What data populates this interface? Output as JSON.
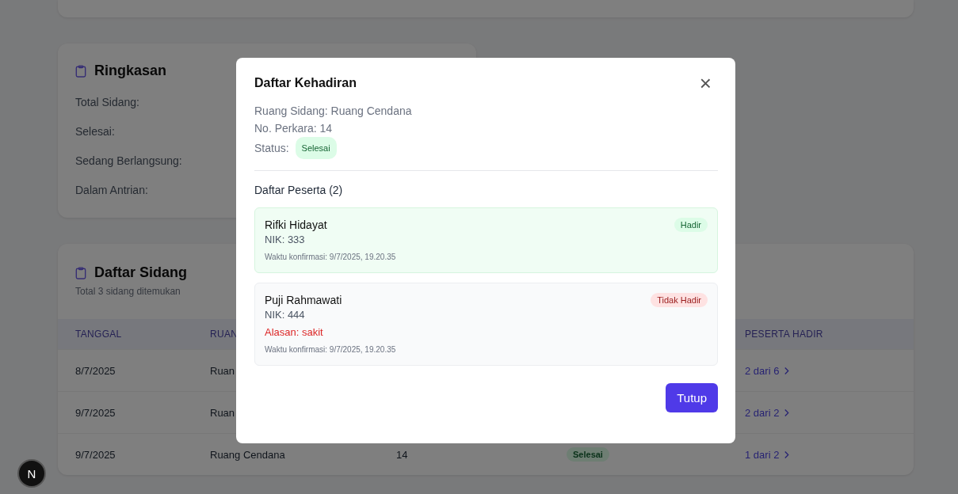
{
  "summary": {
    "title": "Ringkasan",
    "items": [
      {
        "label": "Total Sidang:"
      },
      {
        "label": "Selesai:"
      },
      {
        "label": "Sedang Berlangsung:"
      },
      {
        "label": "Dalam Antrian:"
      }
    ]
  },
  "sessions": {
    "title": "Daftar Sidang",
    "subtitle": "Total 3 sidang ditemukan",
    "columns": {
      "tanggal": "TANGGAL",
      "column_2": "RUAN",
      "peserta_hadir": "PESERTA HADIR"
    },
    "rows": [
      {
        "date": "8/7/2025",
        "room": "Ruan",
        "attendance": "2 dari 6"
      },
      {
        "date": "9/7/2025",
        "room": "Ruan",
        "attendance": "2 dari 2"
      },
      {
        "date": "9/7/2025",
        "room": "Ruang Cendana",
        "case_no": "14",
        "status": {
          "label": "Selesai",
          "kind": "done"
        },
        "attendance": "1 dari 2"
      }
    ]
  },
  "modal": {
    "title": "Daftar Kehadiran",
    "close": "×",
    "info": [
      "Ruang Sidang: Ruang Cendana",
      "No. Perkara: 14"
    ],
    "status_label": "Status:",
    "status": {
      "label": "Selesai",
      "kind": "done"
    },
    "participants_title": "Daftar Peserta (2)",
    "participants": [
      {
        "name": "Rifki Hidayat",
        "nik": "NIK: 333",
        "present": true,
        "badge": "Hadir",
        "confirmed": "Waktu konfirmasi: 9/7/2025, 19.20.35"
      },
      {
        "name": "Puji Rahmawati",
        "nik": "NIK: 444",
        "present": false,
        "badge": "Tidak Hadir",
        "reason": "Alasan: sakit",
        "confirmed": "Waktu konfirmasi: 9/7/2025, 19.20.35"
      }
    ],
    "button": "Tutup"
  },
  "dev_badge": "N"
}
